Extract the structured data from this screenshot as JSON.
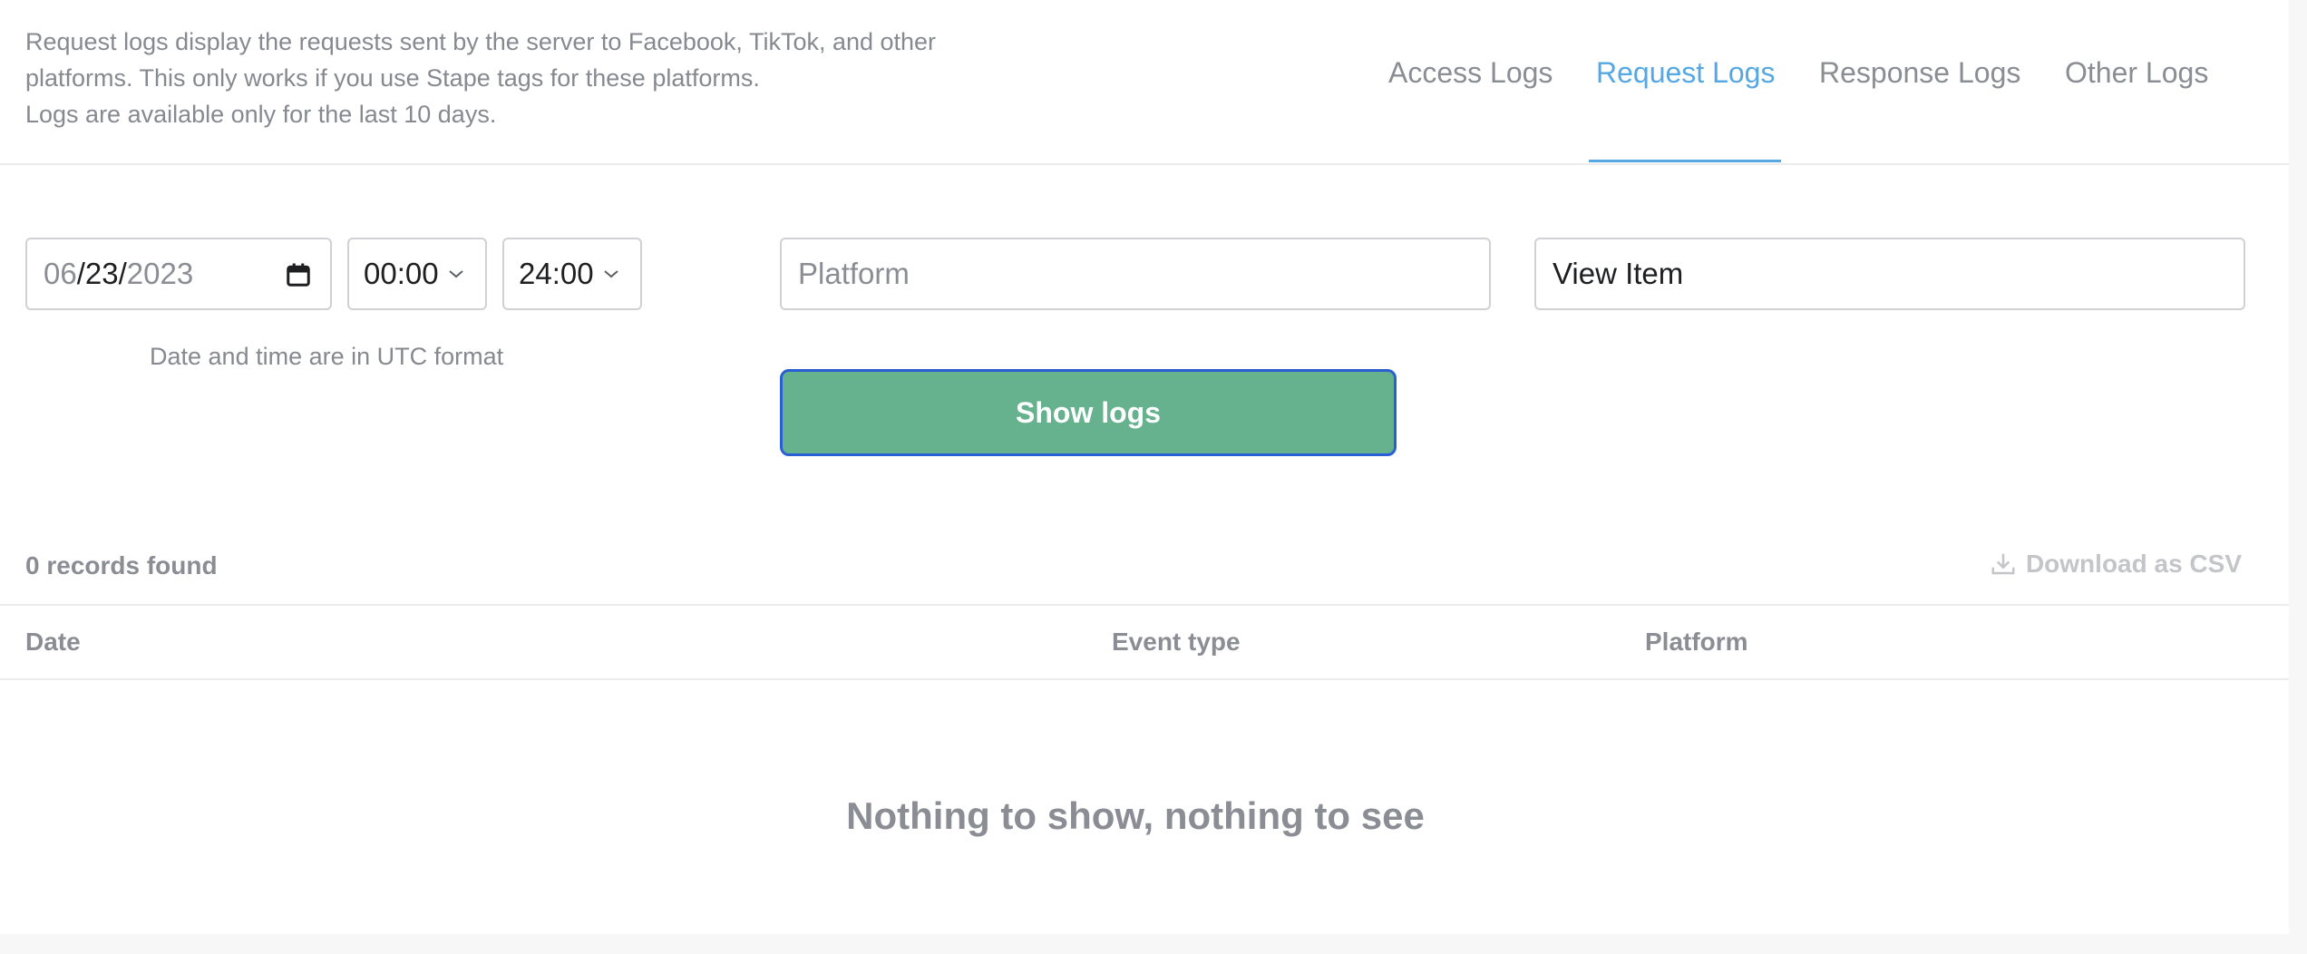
{
  "intro": {
    "line1": "Request logs display the requests sent by the server to Facebook, TikTok, and other",
    "line2": "platforms. This only works if you use Stape tags for these platforms.",
    "line3": "Logs are available only for the last 10 days."
  },
  "tabs": [
    {
      "label": "Access Logs",
      "active": false
    },
    {
      "label": "Request Logs",
      "active": true
    },
    {
      "label": "Response Logs",
      "active": false
    },
    {
      "label": "Other Logs",
      "active": false
    }
  ],
  "filters": {
    "date": {
      "month": "06",
      "day": "23",
      "year": "2023",
      "sep": "/"
    },
    "time_from": "00:00",
    "time_to": "24:00",
    "utc_note": "Date and time are in UTC format",
    "platform_placeholder": "Platform",
    "platform_value": "",
    "event_value": "View Item",
    "show_button": "Show logs"
  },
  "results": {
    "records_found": "0 records found",
    "download_label": "Download as CSV",
    "columns": [
      "Date",
      "Event type",
      "Platform"
    ],
    "empty_message": "Nothing to show, nothing to see"
  },
  "colors": {
    "accent": "#56a8e3",
    "button": "#66b28f",
    "button_border": "#2a5fd4"
  }
}
